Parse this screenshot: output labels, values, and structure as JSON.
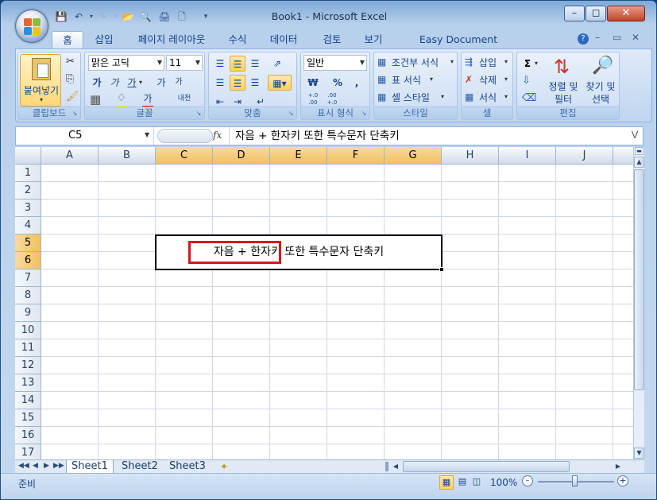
{
  "window": {
    "title": "Book1 - Microsoft Excel"
  },
  "tabs": [
    {
      "label": "홈"
    },
    {
      "label": "삽입"
    },
    {
      "label": "페이지 레이아웃"
    },
    {
      "label": "수식"
    },
    {
      "label": "데이터"
    },
    {
      "label": "검토"
    },
    {
      "label": "보기"
    },
    {
      "label": "Easy Document Creator"
    }
  ],
  "ribbon": {
    "clipboard": {
      "paste_label": "붙여넣기",
      "group_label": "클립보드"
    },
    "font": {
      "name": "맑은 고딕",
      "size": "11",
      "bold": "가",
      "italic": "가",
      "underline": "가",
      "grow": "가",
      "shrink": "가",
      "color_glyph": "가",
      "phonetic": "내천",
      "group_label": "글꼴"
    },
    "alignment": {
      "group_label": "맞춤"
    },
    "number": {
      "format": "일반",
      "currency": "₩",
      "percent": "%",
      "comma": ",",
      "inc_decimal": "+.0 .00",
      "dec_decimal": ".00 +.0",
      "group_label": "표시 형식"
    },
    "styles": {
      "conditional": "조건부 서식",
      "table": "표 서식",
      "cell": "셀 스타일",
      "group_label": "스타일"
    },
    "cells": {
      "insert": "삽입",
      "delete": "삭제",
      "format": "서식",
      "group_label": "셀"
    },
    "editing": {
      "sigma": "Σ",
      "sort_line1": "정렬 및",
      "sort_line2": "필터",
      "find_line1": "찾기 및",
      "find_line2": "선택",
      "group_label": "편집"
    }
  },
  "formula_bar": {
    "name_box": "C5",
    "fx": "fx",
    "content": "자음 + 한자키 또한 특수문자 단축키"
  },
  "grid": {
    "columns": [
      "A",
      "B",
      "C",
      "D",
      "E",
      "F",
      "G",
      "H",
      "I",
      "J"
    ],
    "rows": [
      "1",
      "2",
      "3",
      "4",
      "5",
      "6",
      "7",
      "8",
      "9",
      "10",
      "11",
      "12",
      "13",
      "14",
      "15",
      "16",
      "17"
    ],
    "merged_cell_text": "자음 + 한자키 또한 특수문자 단축키"
  },
  "sheets": [
    "Sheet1",
    "Sheet2",
    "Sheet3"
  ],
  "status": {
    "ready": "준비",
    "zoom": "100%"
  }
}
